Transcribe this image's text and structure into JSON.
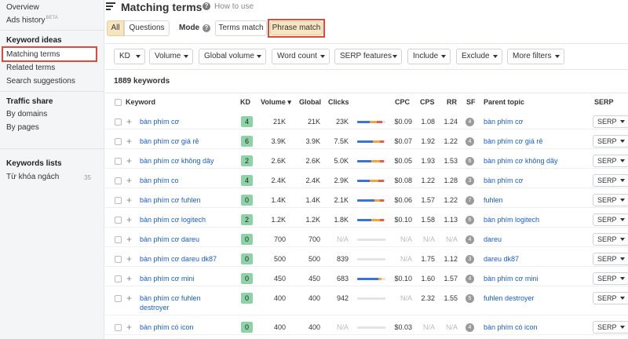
{
  "sidebar": {
    "overview": "Overview",
    "ads_history": "Ads history",
    "ads_history_badge": "BETA",
    "keyword_ideas_heading": "Keyword ideas",
    "matching_terms": "Matching terms",
    "related_terms": "Related terms",
    "search_suggestions": "Search suggestions",
    "traffic_share_heading": "Traffic share",
    "by_domains": "By domains",
    "by_pages": "By pages",
    "keywords_lists_heading": "Keywords lists",
    "list_name": "Từ khóa ngách",
    "list_count": "35"
  },
  "header": {
    "title": "Matching terms",
    "how_to": "How to use"
  },
  "filters": {
    "all": "All",
    "questions": "Questions",
    "mode_label": "Mode",
    "terms_match": "Terms match",
    "phrase_match": "Phrase match",
    "dropdowns": [
      "KD",
      "Volume",
      "Global volume",
      "Word count",
      "SERP features",
      "Include",
      "Exclude",
      "More filters"
    ]
  },
  "summary": {
    "keyword_count": "1889 keywords"
  },
  "table": {
    "headers": {
      "keyword": "Keyword",
      "kd": "KD",
      "volume": "Volume ▾",
      "global": "Global",
      "clicks": "Clicks",
      "cpc": "CPC",
      "cps": "CPS",
      "rr": "RR",
      "sf": "SF",
      "parent": "Parent topic",
      "serp": "SERP"
    },
    "serp_label": "SERP",
    "rows": [
      {
        "keyword": "bàn phím cơ",
        "keyword2": "",
        "kd": "4",
        "volume": "21K",
        "global": "21K",
        "clicks": "23K",
        "cpc": "$0.09",
        "cps": "1.08",
        "rr": "1.24",
        "sf": "4",
        "parent": "bàn phím cơ",
        "kd_color": "#8dd3a7",
        "bar": [
          0.45,
          0.25,
          0.2
        ]
      },
      {
        "keyword": "bàn phím cơ giá rẻ",
        "keyword2": "",
        "kd": "6",
        "volume": "3.9K",
        "global": "3.9K",
        "clicks": "7.5K",
        "cpc": "$0.07",
        "cps": "1.92",
        "rr": "1.22",
        "sf": "4",
        "parent": "bàn phím cơ giá rẻ",
        "kd_color": "#8dd3a7",
        "bar": [
          0.55,
          0.25,
          0.15
        ]
      },
      {
        "keyword": "bàn phím cơ không dây",
        "keyword2": "",
        "kd": "2",
        "volume": "2.6K",
        "global": "2.6K",
        "clicks": "5.0K",
        "cpc": "$0.05",
        "cps": "1.93",
        "rr": "1.53",
        "sf": "6",
        "parent": "bàn phím cơ không dây",
        "kd_color": "#8dd3a7",
        "bar": [
          0.5,
          0.3,
          0.15
        ]
      },
      {
        "keyword": "bàn phím co",
        "keyword2": "",
        "kd": "4",
        "volume": "2.4K",
        "global": "2.4K",
        "clicks": "2.9K",
        "cpc": "$0.08",
        "cps": "1.22",
        "rr": "1.28",
        "sf": "3",
        "parent": "bàn phím cơ",
        "kd_color": "#8dd3a7",
        "bar": [
          0.45,
          0.3,
          0.2
        ]
      },
      {
        "keyword": "bàn phím cơ fuhlen",
        "keyword2": "",
        "kd": "0",
        "volume": "1.4K",
        "global": "1.4K",
        "clicks": "2.1K",
        "cpc": "$0.06",
        "cps": "1.57",
        "rr": "1.22",
        "sf": "7",
        "parent": "fuhlen",
        "kd_color": "#8dd3a7",
        "bar": [
          0.6,
          0.2,
          0.15
        ]
      },
      {
        "keyword": "bàn phím cơ logitech",
        "keyword2": "",
        "kd": "2",
        "volume": "1.2K",
        "global": "1.2K",
        "clicks": "1.8K",
        "cpc": "$0.10",
        "cps": "1.58",
        "rr": "1.13",
        "sf": "6",
        "parent": "bàn phím logitech",
        "kd_color": "#8dd3a7",
        "bar": [
          0.5,
          0.3,
          0.15
        ]
      },
      {
        "keyword": "bàn phím cơ dareu",
        "keyword2": "",
        "kd": "0",
        "volume": "700",
        "global": "700",
        "clicks": "N/A",
        "cpc": "N/A",
        "cps": "N/A",
        "rr": "N/A",
        "sf": "4",
        "parent": "dareu",
        "kd_color": "#8dd3a7",
        "bar": null
      },
      {
        "keyword": "bàn phím cơ dareu dk87",
        "keyword2": "",
        "kd": "0",
        "volume": "500",
        "global": "500",
        "clicks": "839",
        "cpc": "N/A",
        "cps": "1.75",
        "rr": "1.12",
        "sf": "3",
        "parent": "dareu dk87",
        "kd_color": "#8dd3a7",
        "bar": null
      },
      {
        "keyword": "bàn phím cơ mini",
        "keyword2": "",
        "kd": "0",
        "volume": "450",
        "global": "450",
        "clicks": "683",
        "cpc": "$0.10",
        "cps": "1.60",
        "rr": "1.57",
        "sf": "4",
        "parent": "bàn phím cơ mini",
        "kd_color": "#8dd3a7",
        "bar": [
          0.75,
          0.1,
          0.0
        ]
      },
      {
        "keyword": "bàn phím cơ fuhlen",
        "keyword2": "destroyer",
        "kd": "0",
        "volume": "400",
        "global": "400",
        "clicks": "942",
        "cpc": "N/A",
        "cps": "2.32",
        "rr": "1.55",
        "sf": "5",
        "parent": "fuhlen destroyer",
        "kd_color": "#8dd3a7",
        "bar": null
      },
      {
        "keyword": "bàn phím có icon",
        "keyword2": "",
        "kd": "0",
        "volume": "400",
        "global": "400",
        "clicks": "N/A",
        "cpc": "$0.03",
        "cps": "N/A",
        "rr": "N/A",
        "sf": "4",
        "parent": "bàn phím có icon",
        "kd_color": "#8dd3a7",
        "bar": null
      }
    ]
  },
  "colors": {
    "accent_blue": "#1a5ec5",
    "bar_blue": "#3b74d6",
    "bar_orange": "#f0a640",
    "bar_red": "#e35d4a",
    "highlight": "#e04a3a"
  }
}
